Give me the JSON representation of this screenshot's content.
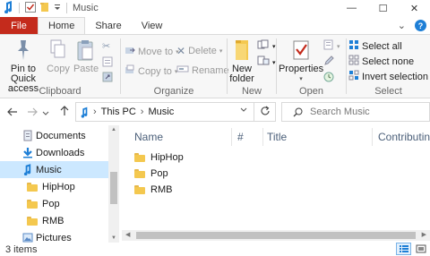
{
  "window": {
    "title": "Music",
    "minimize_glyph": "—",
    "maximize_glyph": "☐",
    "close_glyph": "✕"
  },
  "tabs": [
    {
      "label": "File"
    },
    {
      "label": "Home"
    },
    {
      "label": "Share"
    },
    {
      "label": "View"
    }
  ],
  "tabs_right": {
    "chevron_glyph": "⌄",
    "help_glyph": "?"
  },
  "ribbon": {
    "clipboard": {
      "label": "Clipboard",
      "pin_label_1": "Pin to Quick",
      "pin_label_2": "access",
      "copy": "Copy",
      "paste": "Paste"
    },
    "organize": {
      "label": "Organize",
      "move_to": "Move to",
      "copy_to": "Copy to",
      "delete": "Delete",
      "rename": "Rename"
    },
    "new": {
      "label": "New",
      "new_folder_1": "New",
      "new_folder_2": "folder"
    },
    "open": {
      "label": "Open",
      "properties": "Properties"
    },
    "select": {
      "label": "Select",
      "select_all": "Select all",
      "select_none": "Select none",
      "invert": "Invert selection"
    }
  },
  "address": {
    "path": [
      "This PC",
      "Music"
    ],
    "separator": "›",
    "search_placeholder": "Search Music"
  },
  "nav_pane": {
    "items": [
      {
        "label": "Documents",
        "icon": "documents-icon"
      },
      {
        "label": "Downloads",
        "icon": "downloads-icon"
      },
      {
        "label": "Music",
        "icon": "music-icon"
      },
      {
        "label": "HipHop",
        "icon": "folder-icon"
      },
      {
        "label": "Pop",
        "icon": "folder-icon"
      },
      {
        "label": "RMB",
        "icon": "folder-icon"
      },
      {
        "label": "Pictures",
        "icon": "pictures-icon"
      }
    ]
  },
  "columns": [
    "Name",
    "#",
    "Title",
    "Contributing a"
  ],
  "files": [
    {
      "name": "HipHop"
    },
    {
      "name": "Pop"
    },
    {
      "name": "RMB"
    }
  ],
  "status": {
    "items": "3 items"
  },
  "colors": {
    "file_tab": "#c42b1c",
    "selection": "#cce8ff",
    "folder": "#f4c84f",
    "accent": "#0078d7"
  }
}
